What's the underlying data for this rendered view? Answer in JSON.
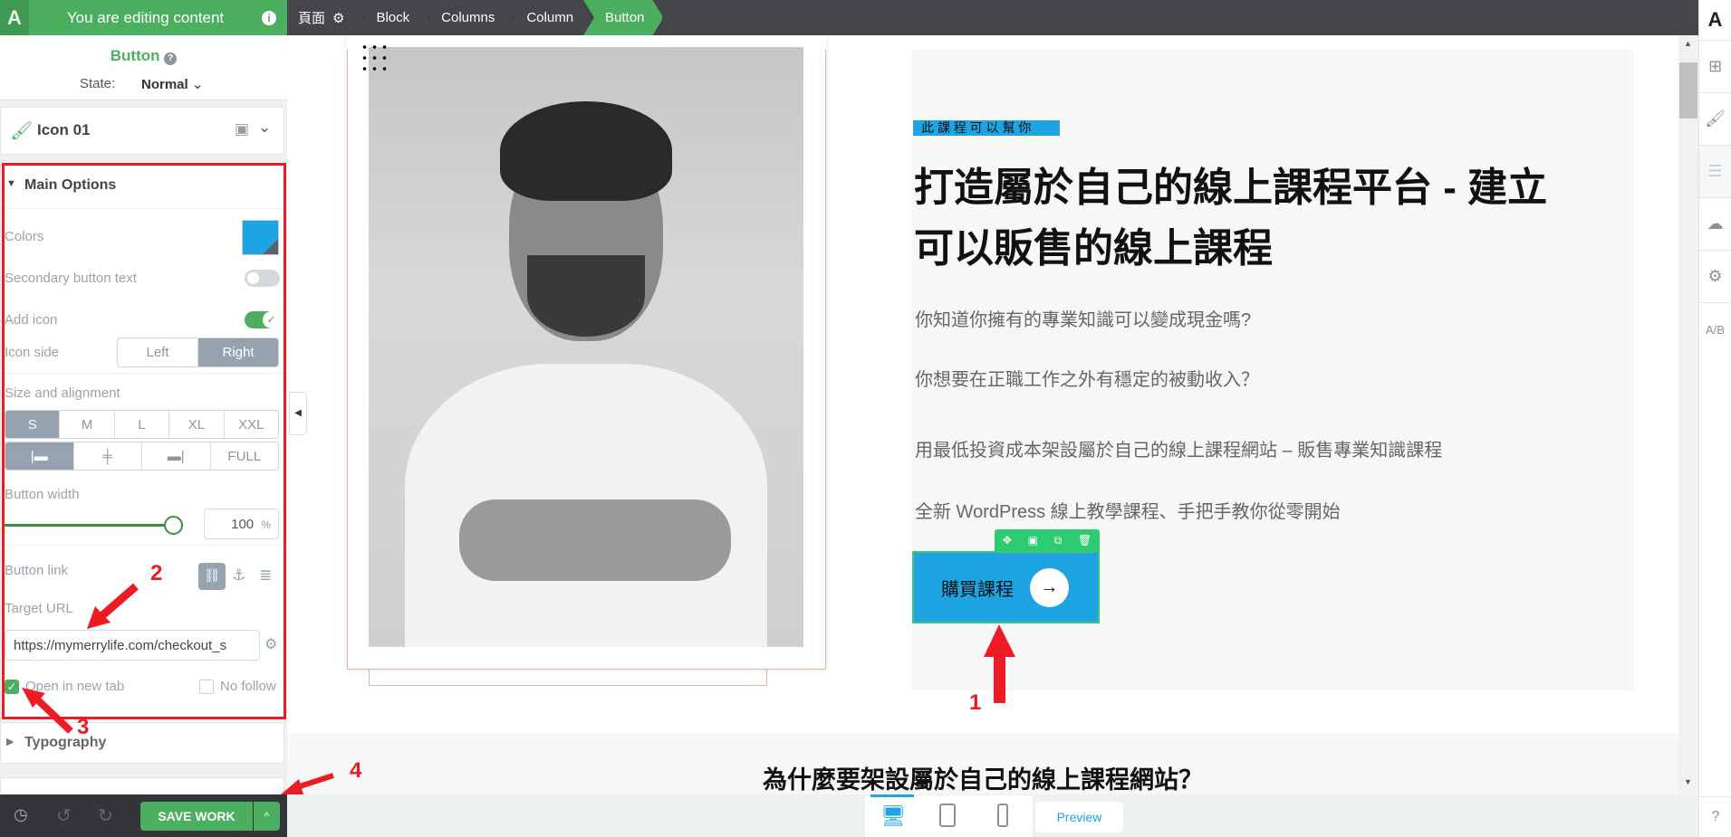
{
  "topbar": {
    "editing_label": "You are editing content",
    "logo": "A"
  },
  "breadcrumbs": [
    "頁面",
    "Block",
    "Columns",
    "Column",
    "Button"
  ],
  "panel": {
    "title": "Button",
    "state_label": "State:",
    "state_value": "Normal",
    "icon_card_label": "Icon 01",
    "main_options": "Main Options",
    "colors_label": "Colors",
    "button_color": "#1ea3e3",
    "secondary_label": "Secondary button text",
    "secondary_on": false,
    "add_icon_label": "Add icon",
    "add_icon_on": true,
    "icon_side_label": "Icon side",
    "icon_side_options": [
      "Left",
      "Right"
    ],
    "icon_side_selected": "Right",
    "size_label": "Size and alignment",
    "sizes": [
      "S",
      "M",
      "L",
      "XL",
      "XXL"
    ],
    "size_selected": "S",
    "align_full": "FULL",
    "width_label": "Button width",
    "width_value": "100",
    "width_unit": "%",
    "link_label": "Button link",
    "target_label": "Target URL",
    "target_url": "https://mymerrylife.com/checkout_s",
    "open_new_tab": "Open in new tab",
    "open_new_tab_checked": true,
    "no_follow": "No follow",
    "no_follow_checked": false,
    "typography": "Typography"
  },
  "bottom": {
    "save": "SAVE WORK",
    "preview": "Preview"
  },
  "content": {
    "tag": "此 課 程 可 以 幫 你",
    "heading_line1": "打造屬於自己的線上課程平台 - 建立",
    "heading_line2": "可以販售的線上課程",
    "paragraphs": [
      "你知道你擁有的專業知識可以變成現金嗎?",
      "你想要在正職工作之外有穩定的被動收入？",
      "用最低投資成本架設屬於自己的線上課程網站 – 販售專業知識課程",
      "全新 WordPress 線上教學課程、手把手教你從零開始"
    ],
    "button_label": "購買課程",
    "section2_heading": "為什麼要架設屬於自己的線上課程網站？"
  },
  "annotations": [
    "1",
    "2",
    "3",
    "4"
  ],
  "colors": {
    "green": "#4caf5f",
    "annotation_red": "#ed1c24",
    "accent_blue": "#1ea3e3"
  }
}
